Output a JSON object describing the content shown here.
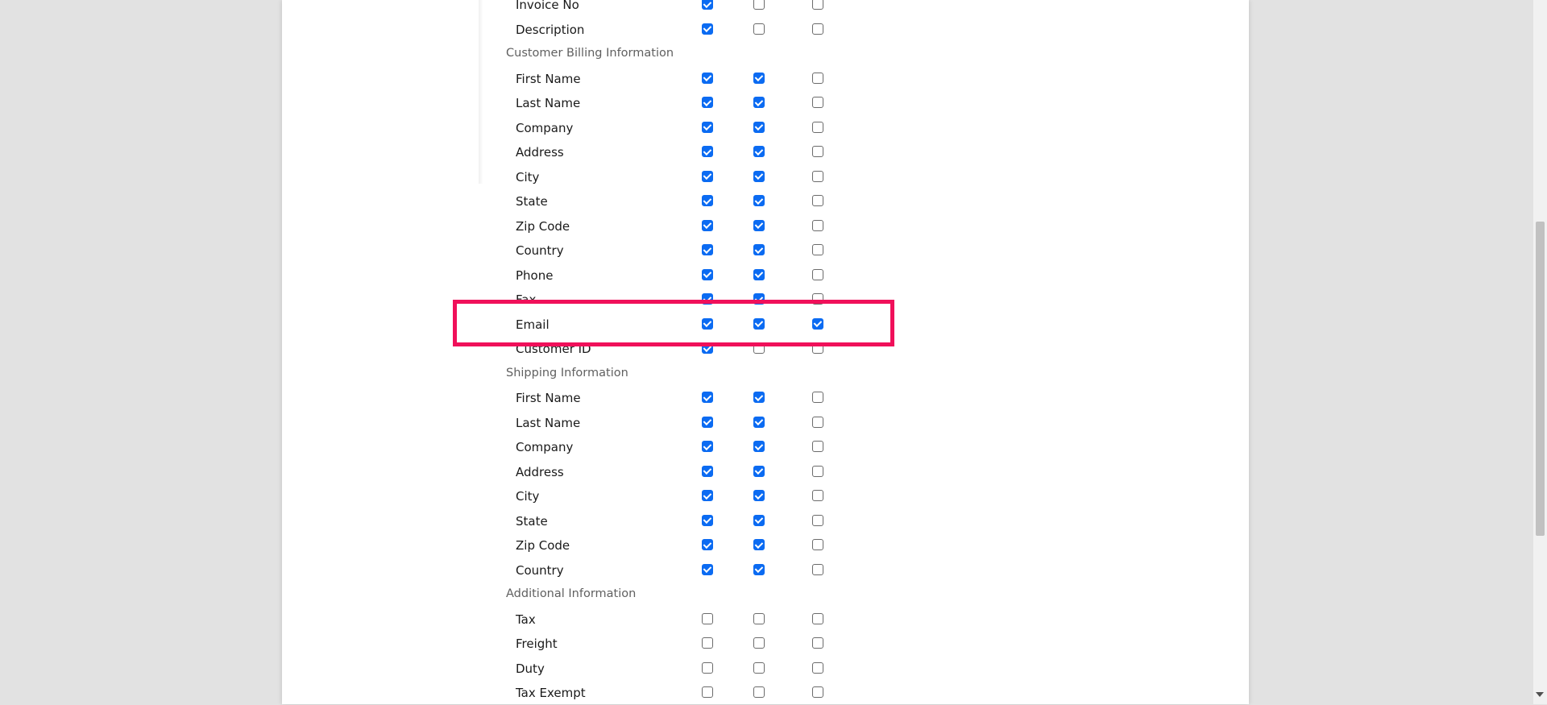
{
  "sections": [
    {
      "header": "",
      "rows": [
        {
          "label": "Invoice No",
          "checks": [
            true,
            false,
            false
          ]
        },
        {
          "label": "Description",
          "checks": [
            true,
            false,
            false
          ]
        }
      ]
    },
    {
      "header": "Customer Billing Information",
      "rows": [
        {
          "label": "First Name",
          "checks": [
            true,
            true,
            false
          ]
        },
        {
          "label": "Last Name",
          "checks": [
            true,
            true,
            false
          ]
        },
        {
          "label": "Company",
          "checks": [
            true,
            true,
            false
          ]
        },
        {
          "label": "Address",
          "checks": [
            true,
            true,
            false
          ]
        },
        {
          "label": "City",
          "checks": [
            true,
            true,
            false
          ]
        },
        {
          "label": "State",
          "checks": [
            true,
            true,
            false
          ]
        },
        {
          "label": "Zip Code",
          "checks": [
            true,
            true,
            false
          ]
        },
        {
          "label": "Country",
          "checks": [
            true,
            true,
            false
          ]
        },
        {
          "label": "Phone",
          "checks": [
            true,
            true,
            false
          ]
        },
        {
          "label": "Fax",
          "checks": [
            true,
            true,
            false
          ]
        },
        {
          "label": "Email",
          "checks": [
            true,
            true,
            true
          ],
          "highlighted": true
        },
        {
          "label": "Customer ID",
          "checks": [
            true,
            false,
            false
          ]
        }
      ]
    },
    {
      "header": "Shipping Information",
      "rows": [
        {
          "label": "First Name",
          "checks": [
            true,
            true,
            false
          ]
        },
        {
          "label": "Last Name",
          "checks": [
            true,
            true,
            false
          ]
        },
        {
          "label": "Company",
          "checks": [
            true,
            true,
            false
          ]
        },
        {
          "label": "Address",
          "checks": [
            true,
            true,
            false
          ]
        },
        {
          "label": "City",
          "checks": [
            true,
            true,
            false
          ]
        },
        {
          "label": "State",
          "checks": [
            true,
            true,
            false
          ]
        },
        {
          "label": "Zip Code",
          "checks": [
            true,
            true,
            false
          ]
        },
        {
          "label": "Country",
          "checks": [
            true,
            true,
            false
          ]
        }
      ]
    },
    {
      "header": "Additional Information",
      "rows": [
        {
          "label": "Tax",
          "checks": [
            false,
            false,
            false
          ]
        },
        {
          "label": "Freight",
          "checks": [
            false,
            false,
            false
          ]
        },
        {
          "label": "Duty",
          "checks": [
            false,
            false,
            false
          ]
        },
        {
          "label": "Tax Exempt",
          "checks": [
            false,
            false,
            false
          ]
        }
      ]
    }
  ],
  "colors": {
    "checkbox_checked": "#0b6bf2",
    "highlight_border": "#f0105a",
    "section_header_text": "#606060"
  }
}
